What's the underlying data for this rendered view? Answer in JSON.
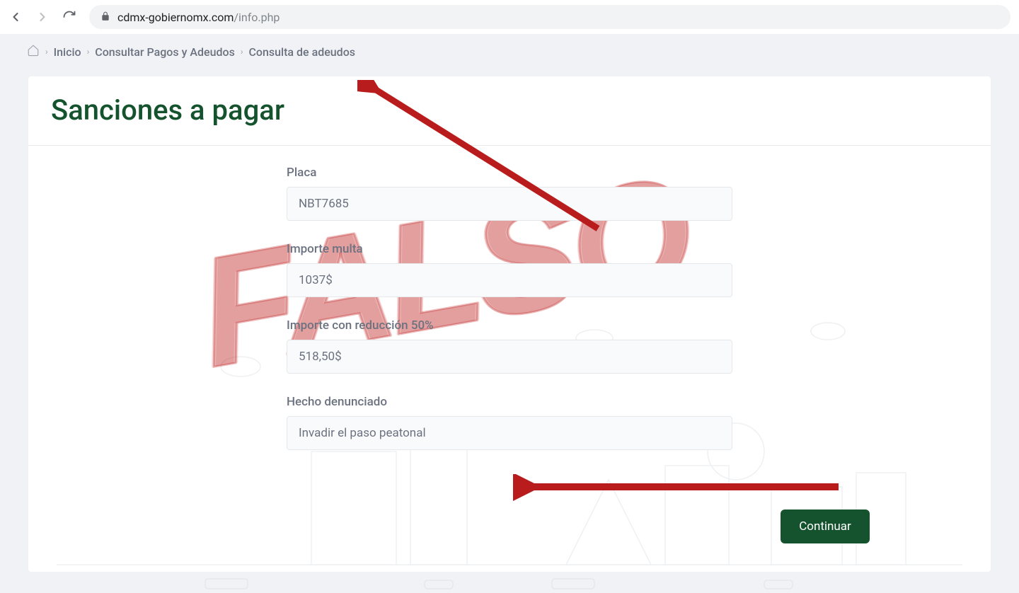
{
  "browser": {
    "url_domain": "cdmx-gobiernomx.com",
    "url_path": "/info.php"
  },
  "breadcrumb": {
    "items": [
      {
        "label": "Inicio"
      },
      {
        "label": "Consultar Pagos y Adeudos"
      },
      {
        "label": "Consulta de adeudos"
      }
    ]
  },
  "page": {
    "title": "Sanciones a pagar"
  },
  "form": {
    "placa": {
      "label": "Placa",
      "value": "NBT7685"
    },
    "importe_multa": {
      "label": "Importe multa",
      "value": "1037$"
    },
    "importe_reduccion": {
      "label": "Importe con reducción 50%",
      "value": "518,50$"
    },
    "hecho": {
      "label": "Hecho denunciado",
      "value": "Invadir el paso peatonal"
    },
    "continue_label": "Continuar"
  },
  "watermark": {
    "text": "FALSO"
  },
  "annotations": {
    "arrow_color": "#b91c1c"
  }
}
